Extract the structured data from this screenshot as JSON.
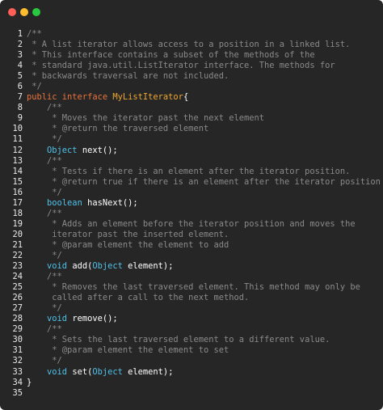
{
  "window": {
    "controls": [
      "close",
      "minimize",
      "maximize"
    ]
  },
  "colors": {
    "background": "#262626",
    "comment": "#8a8a8a",
    "keyword": "#e8743b",
    "type": "#4fc1e9",
    "class_name": "#f0a830",
    "plain": "#ffffff"
  },
  "lines": [
    {
      "n": "1",
      "tokens": [
        {
          "t": "/**",
          "c": "cm"
        }
      ]
    },
    {
      "n": "2",
      "tokens": [
        {
          "t": " * A list iterator allows access to a position in a linked list.",
          "c": "cm"
        }
      ]
    },
    {
      "n": "3",
      "tokens": [
        {
          "t": " * This interface contains a subset of the methods of the",
          "c": "cm"
        }
      ]
    },
    {
      "n": "4",
      "tokens": [
        {
          "t": " * standard java.util.ListIterator interface. The methods for",
          "c": "cm"
        }
      ]
    },
    {
      "n": "5",
      "tokens": [
        {
          "t": " * backwards traversal are not included.",
          "c": "cm"
        }
      ]
    },
    {
      "n": "6",
      "tokens": [
        {
          "t": " */",
          "c": "cm"
        }
      ]
    },
    {
      "n": "7",
      "tokens": [
        {
          "t": "public interface ",
          "c": "kw"
        },
        {
          "t": "MyListIterator",
          "c": "cls"
        },
        {
          "t": "{",
          "c": "pl"
        }
      ]
    },
    {
      "n": "8",
      "tokens": [
        {
          "t": "    /**",
          "c": "cm"
        }
      ]
    },
    {
      "n": "9",
      "tokens": [
        {
          "t": "     * Moves the iterator past the next element",
          "c": "cm"
        }
      ]
    },
    {
      "n": "10",
      "tokens": [
        {
          "t": "     * @return the traversed element",
          "c": "cm"
        }
      ]
    },
    {
      "n": "11",
      "tokens": [
        {
          "t": "     */",
          "c": "cm"
        }
      ]
    },
    {
      "n": "12",
      "tokens": [
        {
          "t": "    ",
          "c": "pl"
        },
        {
          "t": "Object",
          "c": "ty"
        },
        {
          "t": " next();",
          "c": "pl"
        }
      ]
    },
    {
      "n": "13",
      "tokens": [
        {
          "t": "    /**",
          "c": "cm"
        }
      ]
    },
    {
      "n": "14",
      "tokens": [
        {
          "t": "     * Tests if there is an element after the iterator position.",
          "c": "cm"
        }
      ]
    },
    {
      "n": "15",
      "tokens": [
        {
          "t": "     * @return true if there is an element after the iterator position",
          "c": "cm"
        }
      ]
    },
    {
      "n": "16",
      "tokens": [
        {
          "t": "     */",
          "c": "cm"
        }
      ]
    },
    {
      "n": "17",
      "tokens": [
        {
          "t": "    ",
          "c": "pl"
        },
        {
          "t": "boolean",
          "c": "ty"
        },
        {
          "t": " hasNext();",
          "c": "pl"
        }
      ]
    },
    {
      "n": "18",
      "tokens": [
        {
          "t": "    /**",
          "c": "cm"
        }
      ]
    },
    {
      "n": "19",
      "tokens": [
        {
          "t": "     * Adds an element before the iterator position and moves the",
          "c": "cm"
        }
      ]
    },
    {
      "n": "20",
      "tokens": [
        {
          "t": "     iterator past the inserted element.",
          "c": "cm"
        }
      ]
    },
    {
      "n": "21",
      "tokens": [
        {
          "t": "     * @param element the element to add",
          "c": "cm"
        }
      ]
    },
    {
      "n": "22",
      "tokens": [
        {
          "t": "     */",
          "c": "cm"
        }
      ]
    },
    {
      "n": "23",
      "tokens": [
        {
          "t": "    ",
          "c": "pl"
        },
        {
          "t": "void",
          "c": "ty"
        },
        {
          "t": " add(",
          "c": "pl"
        },
        {
          "t": "Object",
          "c": "ty"
        },
        {
          "t": " element);",
          "c": "pl"
        }
      ]
    },
    {
      "n": "24",
      "tokens": [
        {
          "t": "    /**",
          "c": "cm"
        }
      ]
    },
    {
      "n": "25",
      "tokens": [
        {
          "t": "     * Removes the last traversed element. This method may only be",
          "c": "cm"
        }
      ]
    },
    {
      "n": "26",
      "tokens": [
        {
          "t": "     called after a call to the next method.",
          "c": "cm"
        }
      ]
    },
    {
      "n": "27",
      "tokens": [
        {
          "t": "     */",
          "c": "cm"
        }
      ]
    },
    {
      "n": "28",
      "tokens": [
        {
          "t": "    ",
          "c": "pl"
        },
        {
          "t": "void",
          "c": "ty"
        },
        {
          "t": " remove();",
          "c": "pl"
        }
      ]
    },
    {
      "n": "29",
      "tokens": [
        {
          "t": "    /**",
          "c": "cm"
        }
      ]
    },
    {
      "n": "30",
      "tokens": [
        {
          "t": "     * Sets the last traversed element to a different value.",
          "c": "cm"
        }
      ]
    },
    {
      "n": "31",
      "tokens": [
        {
          "t": "     * @param element the element to set",
          "c": "cm"
        }
      ]
    },
    {
      "n": "32",
      "tokens": [
        {
          "t": "     */",
          "c": "cm"
        }
      ]
    },
    {
      "n": "33",
      "tokens": [
        {
          "t": "    ",
          "c": "pl"
        },
        {
          "t": "void",
          "c": "ty"
        },
        {
          "t": " set(",
          "c": "pl"
        },
        {
          "t": "Object",
          "c": "ty"
        },
        {
          "t": " element);",
          "c": "pl"
        }
      ]
    },
    {
      "n": "34",
      "tokens": [
        {
          "t": "}",
          "c": "pl"
        }
      ]
    },
    {
      "n": "35",
      "tokens": []
    }
  ]
}
